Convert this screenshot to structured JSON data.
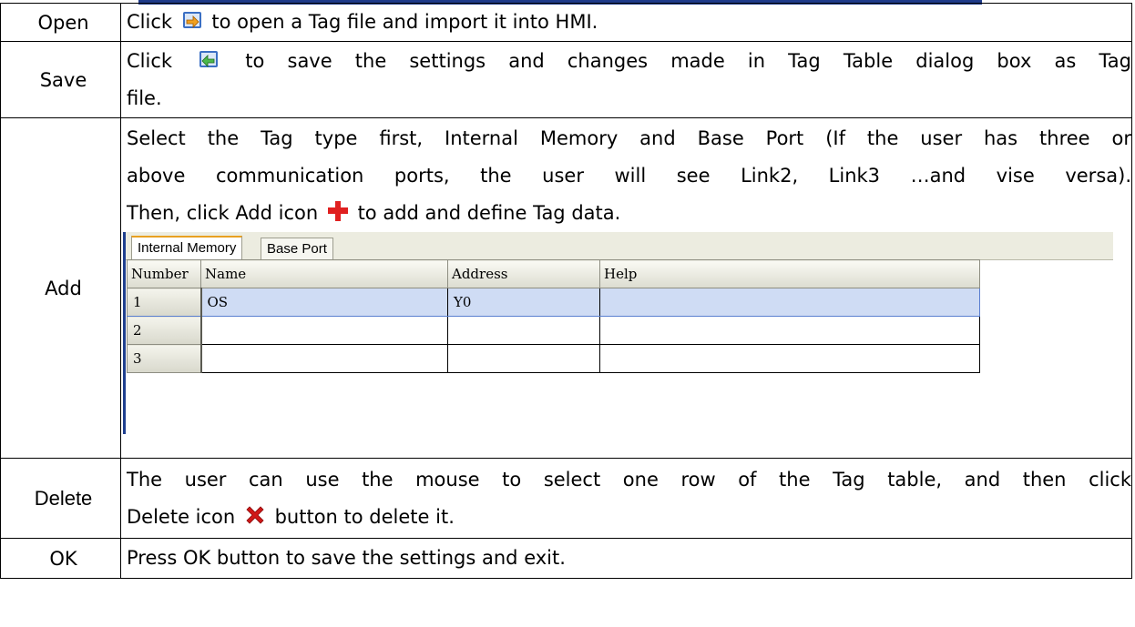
{
  "rows": {
    "open": {
      "label": "Open",
      "pre": "Click",
      "post": "to open a Tag file and import it into HMI."
    },
    "save": {
      "label": "Save",
      "pre": "Click",
      "post": "to save the settings and changes made in Tag Table dialog box as Tag",
      "post2": "file."
    },
    "add": {
      "label": "Add",
      "line1": "Select the Tag type first, Internal Memory and Base Port (If the user has three or",
      "line2": "above communication ports, the user will see Link2, Link3 …and vise versa).",
      "line3_pre": "Then, click Add icon",
      "line3_post": "to add and define Tag data."
    },
    "delete": {
      "label": "Delete",
      "line1": "The user can use the mouse to select one row of the Tag table, and then click",
      "line2_pre": "Delete icon",
      "line2_post": "button to delete it."
    },
    "ok": {
      "label": "OK",
      "text": "Press OK button to save the settings and exit."
    }
  },
  "tag_table": {
    "tabs": [
      "Internal Memory",
      "Base Port"
    ],
    "columns": [
      "Number",
      "Name",
      "Address",
      "Help"
    ],
    "rows": [
      {
        "number": "1",
        "name": "OS",
        "address": "Y0",
        "help": ""
      },
      {
        "number": "2",
        "name": "",
        "address": "",
        "help": ""
      },
      {
        "number": "3",
        "name": "",
        "address": "",
        "help": ""
      }
    ]
  },
  "icons": {
    "open": "open-file-icon",
    "save": "save-file-icon",
    "add": "add-plus-icon",
    "delete": "delete-x-icon"
  },
  "colors": {
    "header_bar": "#1e3a8a",
    "selected_row": "#cfdcf4",
    "add_icon": "#e02020",
    "delete_icon": "#d01818"
  }
}
